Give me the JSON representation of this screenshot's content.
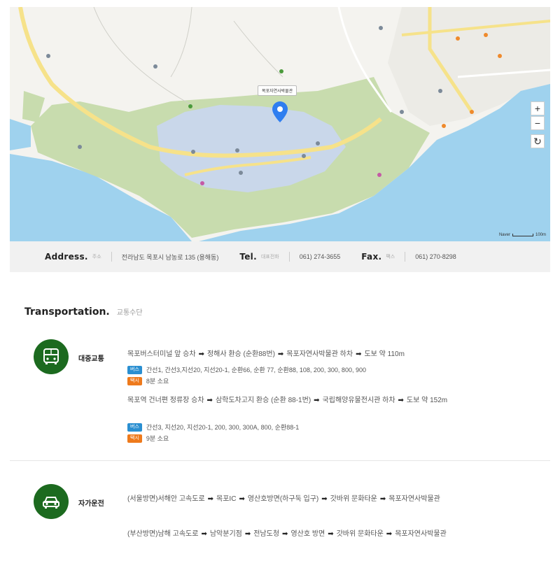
{
  "map": {
    "zoom_in": "+",
    "zoom_out": "−",
    "refresh": "↻",
    "pin_label": "목포자연사박물관",
    "scale_label": "Naver",
    "scale_value": "100m",
    "colors": {
      "water": "#9fd2ee",
      "park": "#c8dcae",
      "road": "#f6e28a",
      "campus": "#c9d7ea",
      "land": "#f4f3ef"
    }
  },
  "address_bar": {
    "address_title": "Address.",
    "address_sub": "주소",
    "address_value": "전라남도 목포시 남농로 135 (용해동)",
    "tel_title": "Tel.",
    "tel_sub": "대표전화",
    "tel_value": "061) 274-3655",
    "fax_title": "Fax.",
    "fax_sub": "팩스",
    "fax_value": "061) 270-8298"
  },
  "transportation": {
    "title": "Transportation.",
    "subtitle": "교통수단",
    "public": {
      "category": "대중교통",
      "icon": "bus-icon",
      "route1": [
        "목포버스터미널 앞 승차",
        "정해사 환승 (순환88번)",
        "목포자연사박물관 하차",
        "도보 약 110m"
      ],
      "route1_bus_badge": "버스",
      "route1_bus": "간선1, 간선3,지선20, 지선20-1, 순환66, 순환 77, 순환88, 108, 200, 300, 800, 900",
      "route1_taxi_badge": "택시",
      "route1_taxi": "8분 소요",
      "route2": [
        "목포역 건너편 정류장 승차",
        "삼학도차고지 환승 (순환 88-1번)",
        "국립해양유물전시관 하차",
        "도보 약 152m"
      ],
      "route2_bus_badge": "버스",
      "route2_bus": "간선3, 지선20, 지선20-1, 200, 300, 300A, 800, 순환88-1",
      "route2_taxi_badge": "택시",
      "route2_taxi": "9분 소요"
    },
    "car": {
      "category": "자가운전",
      "icon": "car-icon",
      "route1": [
        "(서울방면)서해안 고속도로",
        "목포IC",
        "영산호방면(하구둑 입구)",
        "갓바위 문화타운",
        "목포자연사박물관"
      ],
      "route2": [
        "(부산방면)남해 고속도로",
        "남악분기점",
        "전남도청",
        "영산호 방면",
        "갓바위 문화타운",
        "목포자연사박물관"
      ]
    }
  }
}
